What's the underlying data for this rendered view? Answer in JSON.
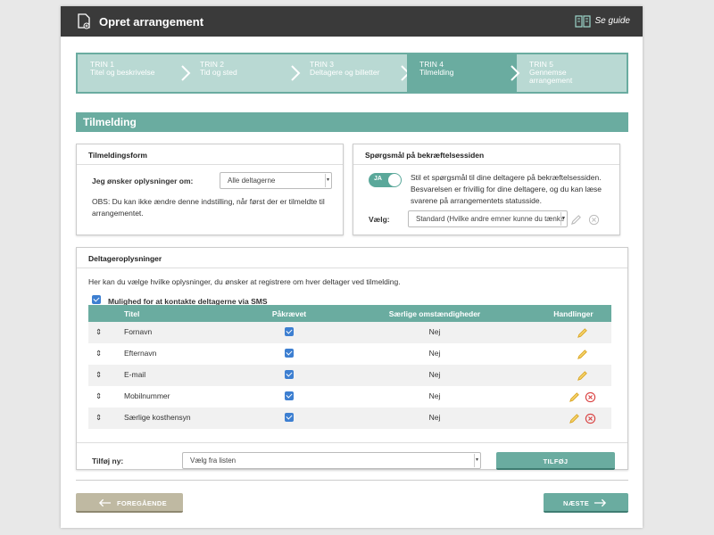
{
  "window": {
    "title": "Opret arrangement",
    "guide_label": "Se guide"
  },
  "steps": [
    {
      "num": "TRIN 1",
      "label": "Titel og beskrivelse"
    },
    {
      "num": "TRIN 2",
      "label": "Tid og sted"
    },
    {
      "num": "TRIN 3",
      "label": "Deltagere og billetter"
    },
    {
      "num": "TRIN 4",
      "label": "Tilmelding"
    },
    {
      "num": "TRIN 5",
      "label": "Gennemse arrangement"
    }
  ],
  "active_step": 4,
  "section_title": "Tilmelding",
  "form": {
    "title": "Tilmeldingsform",
    "ask_label": "Jeg ønsker oplysninger om:",
    "ask_value": "Alle deltagerne",
    "note": "OBS: Du kan ikke ændre denne indstilling, når først der er tilmeldte til arrangementet."
  },
  "question": {
    "title": "Spørgsmål på bekræftelsessiden",
    "toggle_label": "JA",
    "description": "Stil et spørgsmål til dine deltagere på bekræftelsessiden. Besvarelsen er frivillig for dine deltagere, og du kan læse svarene på arrangementets statusside.",
    "select_label": "Vælg:",
    "select_value": "Standard (Hvilke andre emner kunne du tænke"
  },
  "participants": {
    "title": "Deltageroplysninger",
    "intro": "Her kan du vælge hvilke oplysninger, du ønsker at registrere om hver deltager ved tilmelding.",
    "sms_label": "Mulighed for at kontakte deltagerne via SMS",
    "columns": [
      "Titel",
      "Påkrævet",
      "Særlige omstændigheder",
      "Handlinger"
    ],
    "rows": [
      {
        "title": "Fornavn",
        "special": "Nej",
        "deletable": false
      },
      {
        "title": "Efternavn",
        "special": "Nej",
        "deletable": false
      },
      {
        "title": "E-mail",
        "special": "Nej",
        "deletable": false
      },
      {
        "title": "Mobilnummer",
        "special": "Nej",
        "deletable": true
      },
      {
        "title": "Særlige kosthensyn",
        "special": "Nej",
        "deletable": true
      }
    ],
    "add_label": "Tilføj ny:",
    "add_select": "Vælg fra listen",
    "add_button": "TILFØJ"
  },
  "nav": {
    "prev": "FOREGÅENDE",
    "next": "NÆSTE"
  },
  "colors": {
    "accent": "#6aaca0",
    "accent_light": "#b9d9d3",
    "titlebar": "#3a3a3a",
    "checkbox": "#3d7fd1",
    "back_button": "#bfb9a2",
    "pencil": "#e8b73a",
    "delete": "#d94040"
  }
}
